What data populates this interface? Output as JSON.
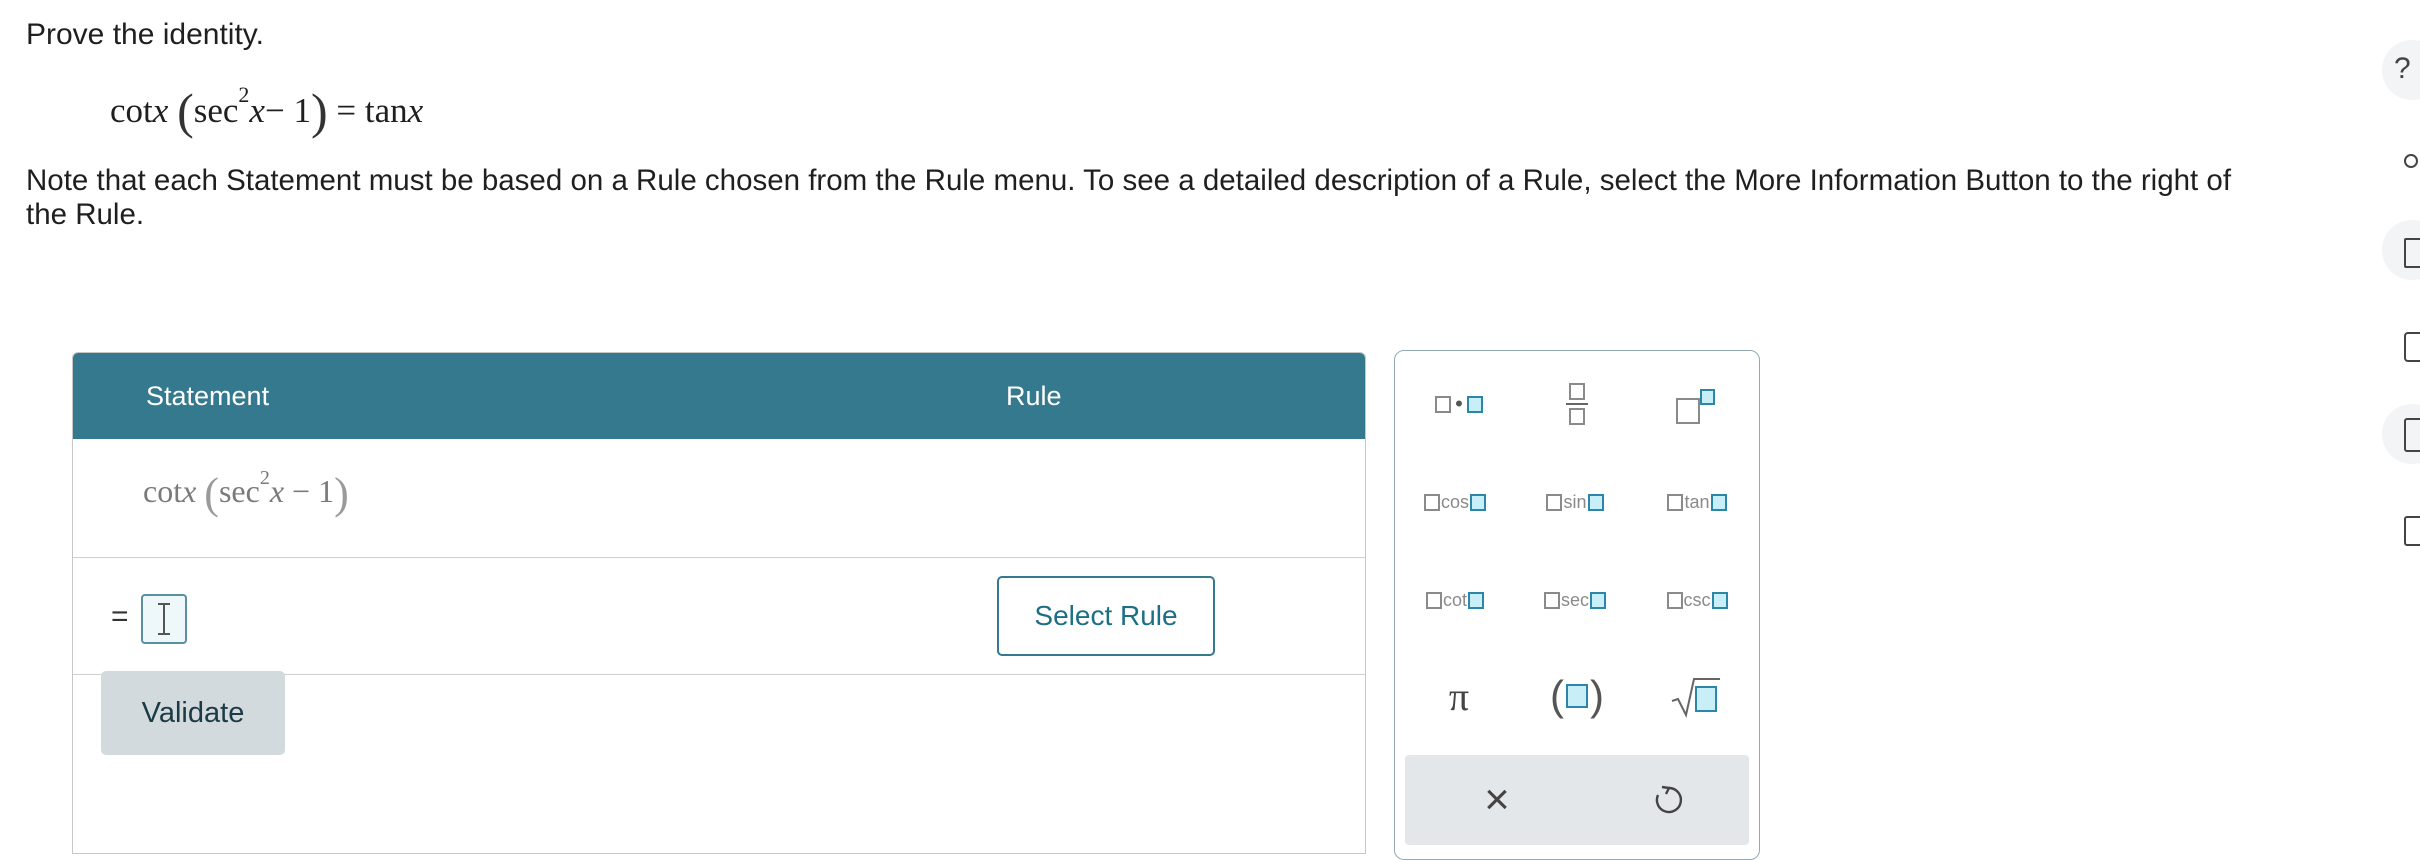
{
  "prompt": "Prove the identity.",
  "identity": {
    "lhs_fn": "cot",
    "var": "x",
    "inner_fn": "sec",
    "exp": "2",
    "minus_one": "− 1",
    "equals": "=",
    "rhs_fn": "tan"
  },
  "note": "Note that each Statement must be based on a Rule chosen from the Rule menu. To see a detailed description of a Rule, select the More Information Button to the right of the Rule.",
  "table": {
    "header_statement": "Statement",
    "header_rule": "Rule",
    "row1": {
      "fn": "cot",
      "var": "x",
      "inner": "sec",
      "exp": "2",
      "tail": "− 1"
    },
    "row2": {
      "equals": "=",
      "select_rule_label": "Select Rule"
    },
    "validate_label": "Validate"
  },
  "palette": {
    "buttons": [
      "times-template",
      "fraction-template",
      "power-template",
      "cos",
      "sin",
      "tan",
      "cot",
      "sec",
      "csc",
      "pi",
      "parentheses-template",
      "sqrt-template"
    ],
    "fn_labels": {
      "cos": "cos",
      "sin": "sin",
      "tan": "tan",
      "cot": "cot",
      "sec": "sec",
      "csc": "csc"
    },
    "pi_symbol": "π",
    "clear_symbol": "×",
    "undo_icon": "undo-icon"
  },
  "colors": {
    "header": "#35798e",
    "accent": "#1d6f86",
    "validate_bg": "#d3dade"
  },
  "side_toolbar_icons": [
    "help-icon",
    "link-icon",
    "textbook-icon",
    "video-icon",
    "calculator-icon",
    "message-icon"
  ]
}
